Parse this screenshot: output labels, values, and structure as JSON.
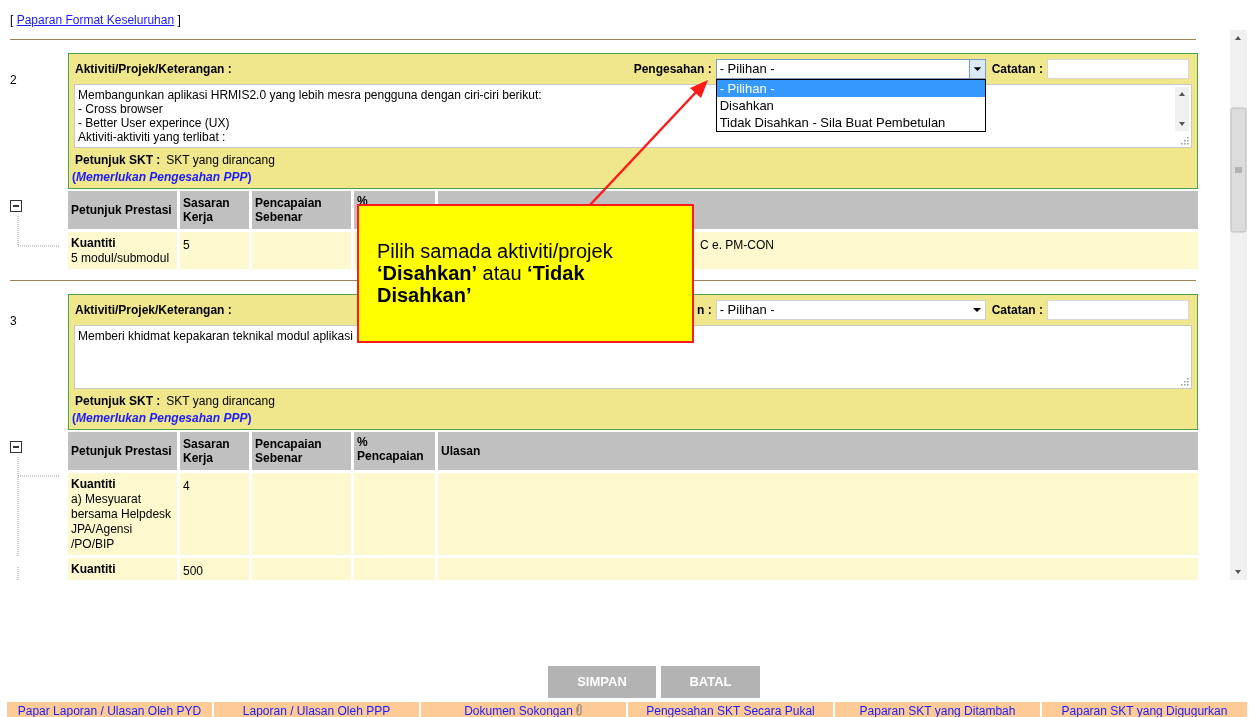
{
  "top_link": {
    "open": "[",
    "label": "Paparan Format Keseluruhan",
    "close": "]"
  },
  "sections": [
    {
      "number": "2",
      "activity_label": "Aktiviti/Projek/Keterangan :",
      "approval_label": "Pengesahan :",
      "approval_value": "- Pilihan -",
      "dropdown_open": true,
      "options": [
        {
          "label": "- Pilihan -",
          "selected": true
        },
        {
          "label": "Disahkan",
          "selected": false
        },
        {
          "label": "Tidak Disahkan - Sila Buat Pembetulan",
          "selected": false
        }
      ],
      "notes_label": "Catatan :",
      "description": "Membangunkan aplikasi HRMIS2.0 yang lebih mesra pengguna dengan ciri-ciri berikut:\n - Cross browser\n - Better User experince (UX)\nAktiviti-aktiviti yang terlibat :",
      "description_scrollbar": true,
      "skt_label": "Petunjuk SKT :",
      "skt_value": "SKT yang dirancang",
      "note_open": "(",
      "note": "Memerlukan Pengesahan PPP",
      "note_close": ")",
      "columns": [
        "Petunjuk Prestasi",
        "Sasaran Kerja",
        "Pencapaian Sebenar",
        "%"
      ],
      "rows": [
        {
          "title": "Kuantiti",
          "detail": "5 modul/submodul",
          "target": "5",
          "remark": "C e. PM-CON"
        }
      ]
    },
    {
      "number": "3",
      "activity_label": "Aktiviti/Projek/Keterangan :",
      "approval_label": "n :",
      "approval_value": "- Pilihan -",
      "dropdown_open": false,
      "notes_label": "Catatan :",
      "description": "Memberi khidmat kepakaran teknikal modul aplikasi",
      "description_scrollbar": false,
      "skt_label": "Petunjuk SKT :",
      "skt_value": "SKT yang dirancang",
      "note_open": "(",
      "note": "Memerlukan Pengesahan PPP",
      "note_close": ")",
      "columns": [
        "Petunjuk Prestasi",
        "Sasaran Kerja",
        "Pencapaian Sebenar",
        "% Pencapaian",
        "Ulasan"
      ],
      "rows": [
        {
          "title": "Kuantiti",
          "detail": "a) Mesyuarat bersama Helpdesk JPA/Agensi /PO/BIP",
          "target": "4"
        },
        {
          "title": "Kuantiti",
          "target": "500"
        }
      ]
    }
  ],
  "callout": "Pilih samada aktiviti/projek **‘Disahkan’** atau **‘Tidak Disahkan’**",
  "buttons": [
    "SIMPAN",
    "BATAL"
  ],
  "footer_tabs": [
    {
      "label": "Papar Laporan / Ulasan Oleh PYD",
      "attachment": false
    },
    {
      "label": "Laporan / Ulasan Oleh PPP",
      "attachment": false
    },
    {
      "label": "Dokumen Sokongan",
      "attachment": true
    },
    {
      "label": "Pengesahan SKT Secara Pukal",
      "attachment": false
    },
    {
      "label": "Paparan SKT yang Ditambah",
      "attachment": false
    },
    {
      "label": "Paparan SKT yang Digugurkan",
      "attachment": false
    }
  ]
}
